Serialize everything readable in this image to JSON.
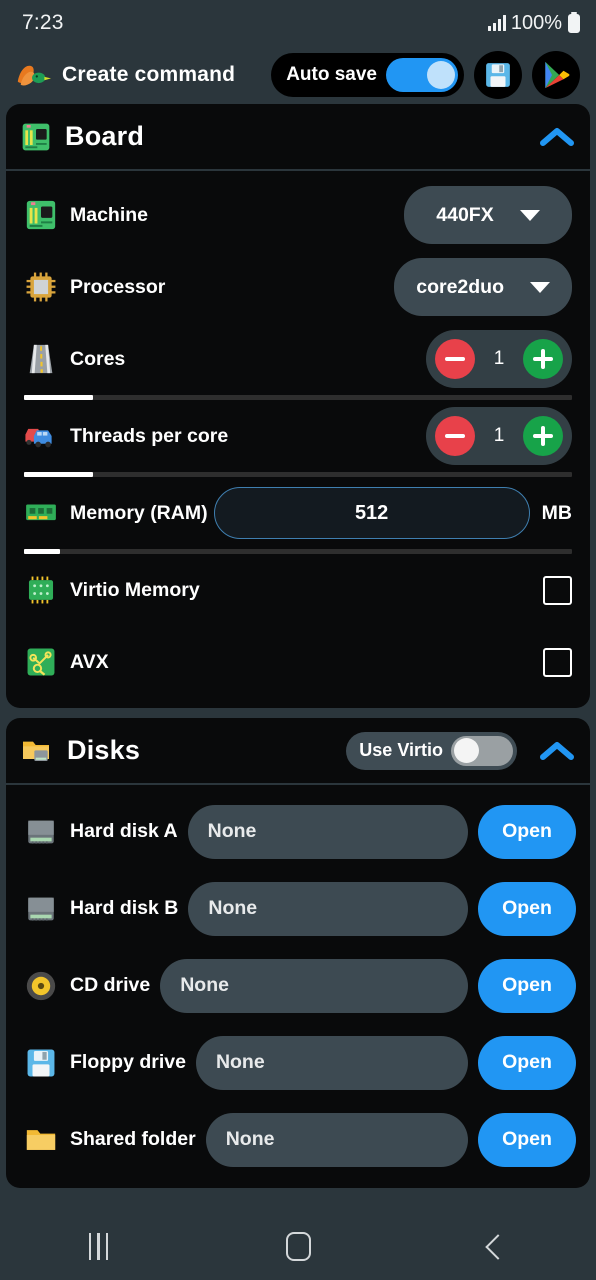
{
  "status_bar": {
    "time": "7:23",
    "battery_percent": "100%",
    "signal_icon": "signal-bars-icon",
    "battery_icon": "battery-full-icon"
  },
  "app_bar": {
    "logo_icon": "qemu-logo-icon",
    "title": "Create command",
    "auto_save_label": "Auto save",
    "auto_save_on": true,
    "save_icon": "floppy-save-icon",
    "play_store_icon": "play-store-icon"
  },
  "sections": [
    {
      "id": "board",
      "icon": "motherboard-icon",
      "title": "Board",
      "collapse_icon": "chevron-up-icon",
      "expanded": true,
      "rows": [
        {
          "type": "dropdown",
          "icon": "motherboard-icon",
          "label": "Machine",
          "value": "440FX",
          "caret_icon": "chevron-down-icon"
        },
        {
          "type": "dropdown",
          "icon": "cpu-chip-icon",
          "label": "Processor",
          "value": "core2duo",
          "caret_icon": "chevron-down-icon"
        },
        {
          "type": "stepper",
          "icon": "road-icon",
          "label": "Cores",
          "value": "1",
          "minus_icon": "minus-circle-icon",
          "plus_icon": "plus-circle-icon",
          "slider_percent": 12.5
        },
        {
          "type": "stepper",
          "icon": "multiple-cars-icon",
          "label": "Threads per core",
          "value": "1",
          "minus_icon": "minus-circle-icon",
          "plus_icon": "plus-circle-icon",
          "slider_percent": 12.5
        },
        {
          "type": "textfield",
          "icon": "ram-stick-icon",
          "label": "Memory (RAM)",
          "value": "512",
          "unit": "MB",
          "slider_percent": 6.6
        },
        {
          "type": "checkbox",
          "icon": "virtio-chip-icon",
          "label": "Virtio Memory",
          "checked": false
        },
        {
          "type": "checkbox",
          "icon": "circuit-node-icon",
          "label": "AVX",
          "checked": false
        }
      ]
    },
    {
      "id": "disks",
      "icon": "folder-disk-icon",
      "title": "Disks",
      "collapse_icon": "chevron-up-icon",
      "expanded": true,
      "use_virtio_label": "Use Virtio",
      "use_virtio_on": false,
      "rows": [
        {
          "icon": "hard-disk-icon",
          "label": "Hard disk A",
          "value": "None",
          "button": "Open"
        },
        {
          "icon": "hard-disk-icon",
          "label": "Hard disk B",
          "value": "None",
          "button": "Open"
        },
        {
          "icon": "cd-disc-icon",
          "label": "CD drive",
          "value": "None",
          "button": "Open"
        },
        {
          "icon": "floppy-disk-icon",
          "label": "Floppy drive",
          "value": "None",
          "button": "Open"
        },
        {
          "icon": "folder-icon",
          "label": "Shared folder",
          "value": "None",
          "button": "Open"
        }
      ]
    }
  ],
  "nav_bar": {
    "recent_icon": "recent-apps-icon",
    "home_icon": "home-icon",
    "back_icon": "back-icon"
  },
  "colors": {
    "page_bg": "#2b363c",
    "card_bg": "#090a0b",
    "accent_blue": "#2196f3",
    "field_bg": "#3d4a52",
    "minus_red": "#e8414a",
    "plus_green": "#17a349",
    "memory_border": "#3f7fb0"
  }
}
